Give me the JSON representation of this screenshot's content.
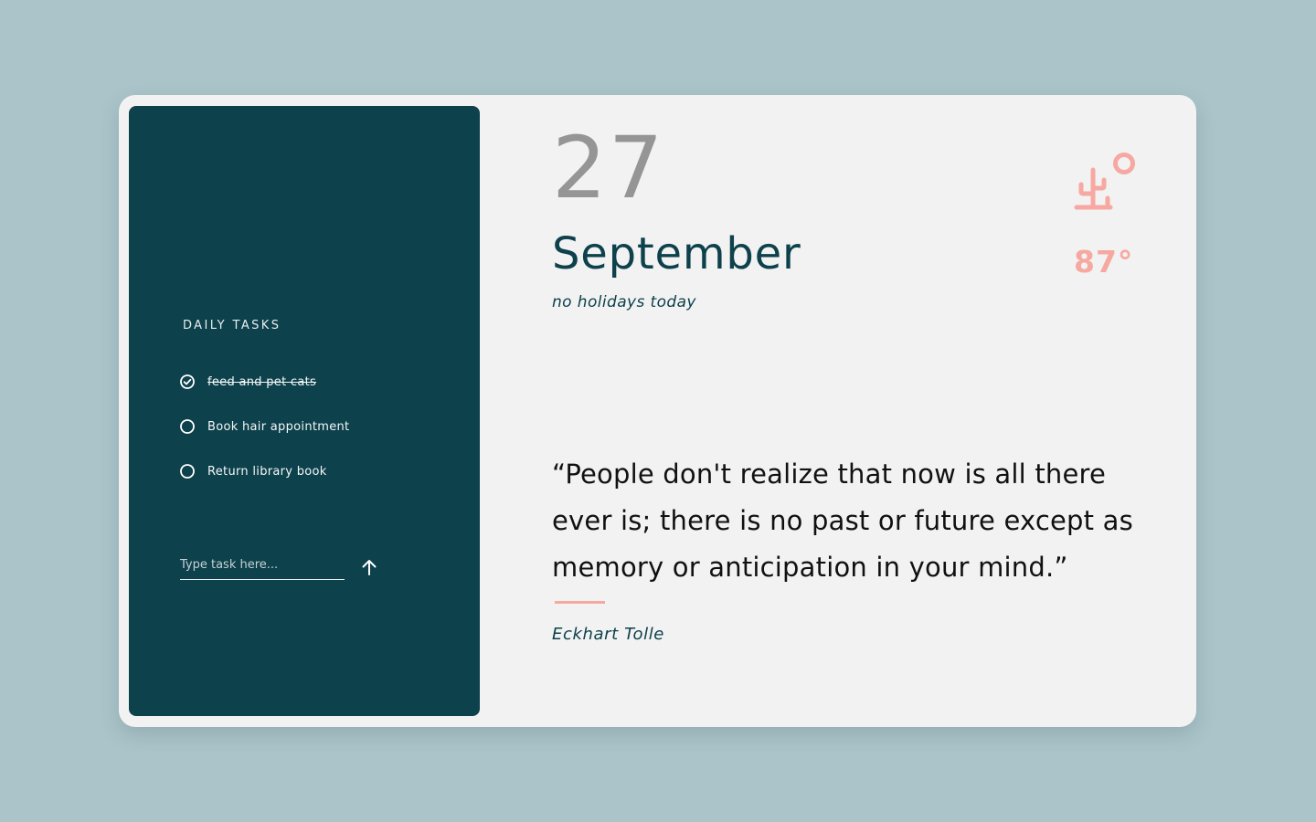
{
  "tasks": {
    "title": "DAILY TASKS",
    "items": [
      {
        "label": "feed and pet cats",
        "done": true
      },
      {
        "label": "Book hair appointment",
        "done": false
      },
      {
        "label": "Return library book",
        "done": false
      }
    ],
    "input_placeholder": "Type task here...",
    "input_value": "",
    "add_icon": "arrow-up-icon"
  },
  "date": {
    "day": "27",
    "month": "September",
    "holiday_text": "no holidays today"
  },
  "weather": {
    "icon": "desert-cactus-sun-icon",
    "temperature": "87°"
  },
  "quote": {
    "text": "“People don't realize that now is all there ever is; there is no past or future except as memory or anticipation in your mind.”",
    "author": "Eckhart Tolle"
  },
  "colors": {
    "background": "#abc4c9",
    "card": "#f2f2f2",
    "sidebar": "#0d414c",
    "accent": "#f6a8a1",
    "day_number": "#959595",
    "text_dark": "#0d414c"
  }
}
